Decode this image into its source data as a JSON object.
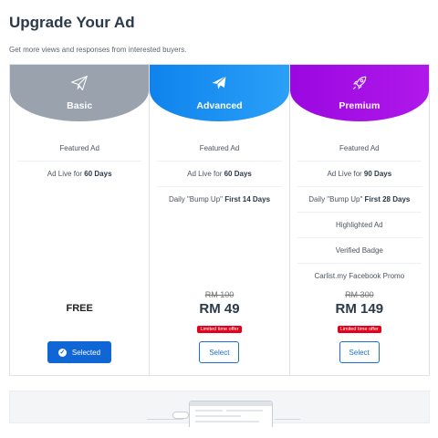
{
  "header": {
    "title": "Upgrade Your Ad",
    "subtitle": "Get more views and responses from interested buyers."
  },
  "plans": [
    {
      "name": "Basic",
      "icon": "paper-plane-icon",
      "header_color": "#9aa3ad",
      "features": [
        {
          "text": "Featured Ad"
        },
        {
          "text": "Ad Live for ",
          "bold": "60 Days"
        }
      ],
      "price_label": "FREE",
      "button_label": "Selected",
      "selected": true
    },
    {
      "name": "Advanced",
      "icon": "airplane-icon",
      "header_color": "#1a8cf0",
      "features": [
        {
          "text": "Featured Ad"
        },
        {
          "text": "Ad Live for ",
          "bold": "60 Days"
        },
        {
          "text": "Daily \"Bump Up\" ",
          "bold": "First 14 Days"
        }
      ],
      "old_price": "RM 100",
      "price": "RM 49",
      "offer": "Limited time offer",
      "button_label": "Select",
      "selected": false
    },
    {
      "name": "Premium",
      "icon": "rocket-icon",
      "header_color": "#a20fe0",
      "features": [
        {
          "text": "Featured Ad"
        },
        {
          "text": "Ad Live for ",
          "bold": "90 Days"
        },
        {
          "text": "Daily \"Bump Up\" ",
          "bold": "First 28 Days"
        },
        {
          "text": "Highlighted Ad"
        },
        {
          "text": "Verified Badge"
        },
        {
          "text": "Carlist.my Facebook Promo"
        }
      ],
      "old_price": "RM 300",
      "price": "RM 149",
      "offer": "Limited time offer",
      "button_label": "Select",
      "selected": false
    }
  ]
}
